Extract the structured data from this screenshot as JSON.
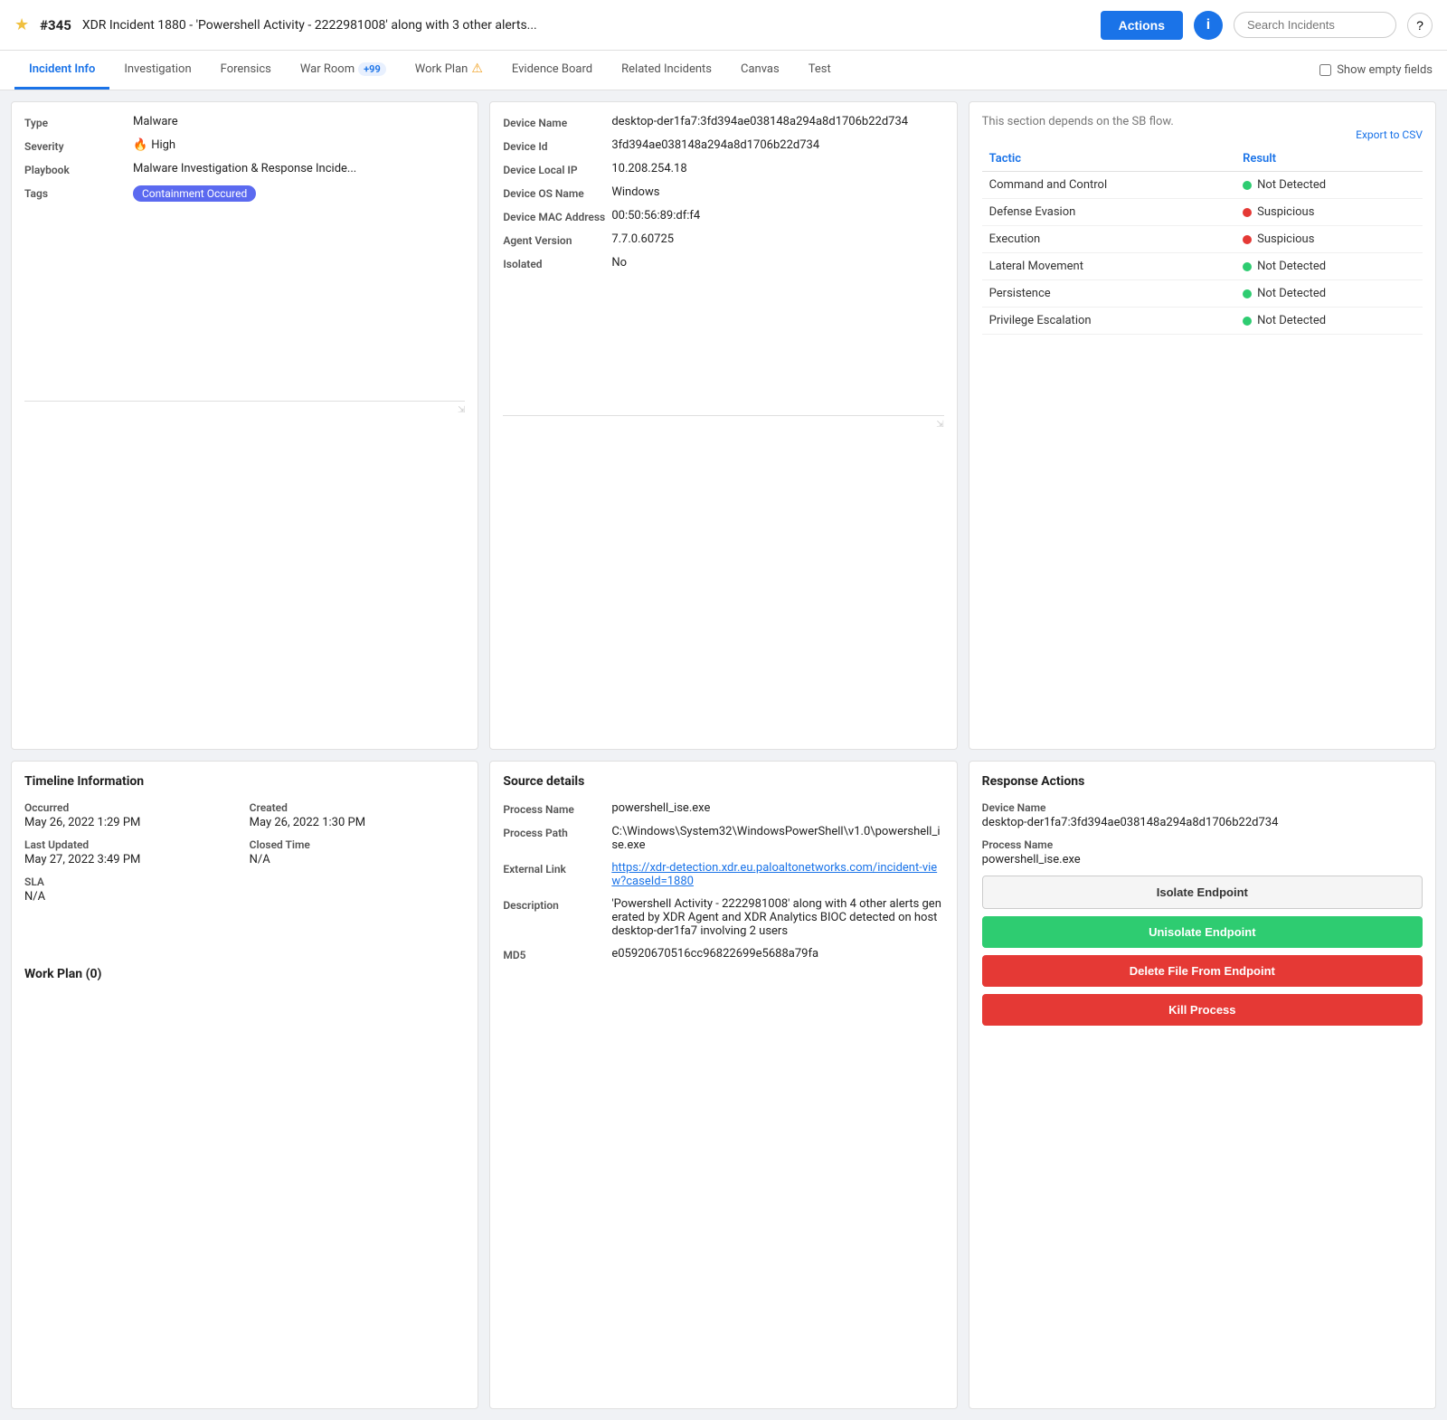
{
  "header": {
    "star": "★",
    "incident_number": "#345",
    "incident_title": "XDR Incident 1880 - 'Powershell Activity - 2222981008' along with 3 other alerts...",
    "actions_label": "Actions",
    "info_icon": "i",
    "search_placeholder": "Search Incidents",
    "help_icon": "?"
  },
  "tabs": [
    {
      "label": "Incident Info",
      "active": true,
      "badge": null,
      "warning": false
    },
    {
      "label": "Investigation",
      "active": false,
      "badge": null,
      "warning": false
    },
    {
      "label": "Forensics",
      "active": false,
      "badge": null,
      "warning": false
    },
    {
      "label": "War Room",
      "active": false,
      "badge": "+99",
      "warning": false
    },
    {
      "label": "Work Plan",
      "active": false,
      "badge": null,
      "warning": true
    },
    {
      "label": "Evidence Board",
      "active": false,
      "badge": null,
      "warning": false
    },
    {
      "label": "Related Incidents",
      "active": false,
      "badge": null,
      "warning": false
    },
    {
      "label": "Canvas",
      "active": false,
      "badge": null,
      "warning": false
    },
    {
      "label": "Test",
      "active": false,
      "badge": null,
      "warning": false
    }
  ],
  "show_empty_fields": "Show empty fields",
  "incident_info": {
    "type_label": "Type",
    "type_value": "Malware",
    "severity_label": "Severity",
    "severity_value": "High",
    "playbook_label": "Playbook",
    "playbook_value": "Malware Investigation & Response Incide...",
    "tags_label": "Tags",
    "tags_value": "Containment Occured"
  },
  "device_info": {
    "device_name_label": "Device Name",
    "device_name_value": "desktop-der1fa7:3fd394ae038148a294a8d1706b22d734",
    "device_id_label": "Device Id",
    "device_id_value": "3fd394ae038148a294a8d1706b22d734",
    "device_local_ip_label": "Device Local IP",
    "device_local_ip_value": "10.208.254.18",
    "device_os_name_label": "Device OS Name",
    "device_os_name_value": "Windows",
    "device_mac_label": "Device MAC Address",
    "device_mac_value": "00:50:56:89:df:f4",
    "agent_version_label": "Agent Version",
    "agent_version_value": "7.7.0.60725",
    "isolated_label": "Isolated",
    "isolated_value": "No"
  },
  "sb_flow": {
    "text": "This section depends on the SB flow.",
    "export_csv": "Export to CSV"
  },
  "tactic_table": {
    "col_tactic": "Tactic",
    "col_result": "Result",
    "rows": [
      {
        "tactic": "Command and Control",
        "result": "Not Detected",
        "status": "green"
      },
      {
        "tactic": "Defense Evasion",
        "result": "Suspicious",
        "status": "red"
      },
      {
        "tactic": "Execution",
        "result": "Suspicious",
        "status": "red"
      },
      {
        "tactic": "Lateral Movement",
        "result": "Not Detected",
        "status": "green"
      },
      {
        "tactic": "Persistence",
        "result": "Not Detected",
        "status": "green"
      },
      {
        "tactic": "Privilege Escalation",
        "result": "Not Detected",
        "status": "green"
      }
    ]
  },
  "timeline": {
    "title": "Timeline Information",
    "occurred_label": "Occurred",
    "occurred_value": "May 26, 2022 1:29 PM",
    "created_label": "Created",
    "created_value": "May 26, 2022 1:30 PM",
    "last_updated_label": "Last Updated",
    "last_updated_value": "May 27, 2022 3:49 PM",
    "closed_time_label": "Closed Time",
    "closed_time_value": "N/A",
    "sla_label": "SLA",
    "sla_value": "N/A"
  },
  "source_details": {
    "title": "Source details",
    "process_name_label": "Process Name",
    "process_name_value": "powershell_ise.exe",
    "process_path_label": "Process Path",
    "process_path_value": "C:\\Windows\\System32\\WindowsPowerShell\\v1.0\\powershell_ise.exe",
    "external_link_label": "External Link",
    "external_link_value": "https://xdr-detection.xdr.eu.paloaltonetworks.com/incident-view?caseId=1880",
    "description_label": "Description",
    "description_value": "'Powershell Activity - 2222981008' along with 4 other alerts generated by XDR Agent and XDR Analytics BIOC detected on host desktop-der1fa7 involving 2 users",
    "md5_label": "MD5",
    "md5_value": "e05920670516cc96822699e5688a79fa"
  },
  "response_actions": {
    "title": "Response Actions",
    "device_name_label": "Device Name",
    "device_name_value": "desktop-der1fa7:3fd394ae038148a294a8d1706b22d734",
    "process_name_label": "Process Name",
    "process_name_value": "powershell_ise.exe",
    "btn_isolate": "Isolate Endpoint",
    "btn_unisolate": "Unisolate Endpoint",
    "btn_delete": "Delete File From Endpoint",
    "btn_kill": "Kill Process"
  },
  "work_plan": {
    "title": "Work Plan (0)"
  }
}
